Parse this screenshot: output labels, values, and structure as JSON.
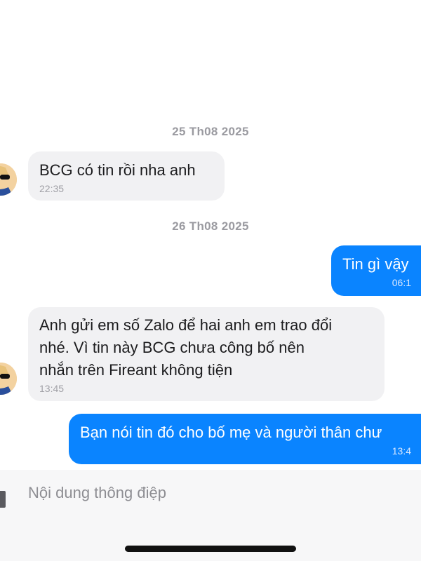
{
  "conversation": {
    "date_1": "25 Th08 2025",
    "date_2": "26 Th08 2025",
    "messages": [
      {
        "direction": "incoming",
        "text": "BCG có tin rồi nha anh",
        "time": "22:35"
      },
      {
        "direction": "outgoing",
        "text": "Tin gì vậy",
        "time": "06:1"
      },
      {
        "direction": "incoming",
        "text": "Anh gửi em số Zalo để hai anh em trao đổi\nnhé. Vì tin này BCG chưa công bố nên\nnhắn trên Fireant không tiện",
        "time": "13:45"
      },
      {
        "direction": "outgoing",
        "text": "Bạn nói tin đó cho bố mẹ và người thân chư",
        "time": "13:4"
      }
    ]
  },
  "composer": {
    "placeholder": "Nội dung thông điệp"
  },
  "colors": {
    "outgoing_bubble": "#0a84ff",
    "incoming_bubble": "#f1f1f3"
  }
}
